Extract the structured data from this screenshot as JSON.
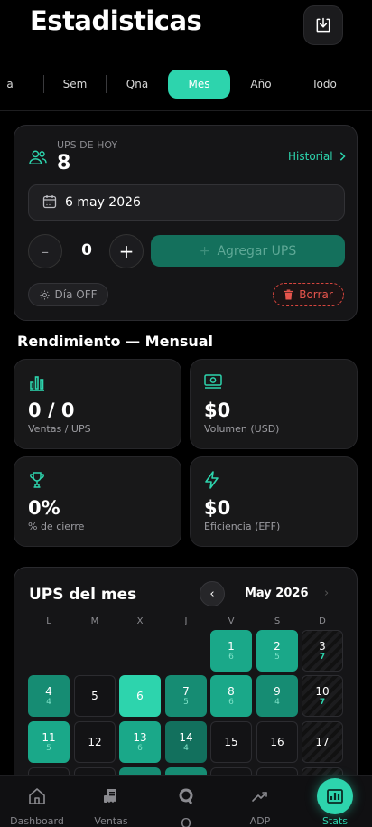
{
  "header": {
    "title": "Estadisticas"
  },
  "tabs": [
    "a",
    "Sem",
    "Qna",
    "Mes",
    "Año",
    "Todo"
  ],
  "active_tab": "Mes",
  "ups_card": {
    "label": "UPS DE HOY",
    "value": "8",
    "history_label": "Historial",
    "date": "6 may 2026",
    "quantity": "0",
    "minus": "–",
    "plus": "+",
    "add_button": "Agregar UPS",
    "add_icon": "+",
    "day_off": "Día OFF",
    "delete": "Borrar"
  },
  "performance": {
    "title": "Rendimiento — Mensual",
    "metrics": [
      {
        "icon": "bar-chart-icon",
        "value": "0 / 0",
        "label": "Ventas / UPS"
      },
      {
        "icon": "money-icon",
        "value": "$0",
        "label": "Volumen (USD)"
      },
      {
        "icon": "trophy-icon",
        "value": "0%",
        "label": "% de cierre"
      },
      {
        "icon": "lightning-icon",
        "value": "$0",
        "label": "Eficiencia (EFF)"
      }
    ]
  },
  "calendar": {
    "title": "UPS del mes",
    "month": "May 2026",
    "prev": "‹",
    "next": "›",
    "weekdays": [
      "L",
      "M",
      "X",
      "J",
      "V",
      "S",
      "D"
    ],
    "days": [
      {
        "n": "1",
        "s": "6"
      },
      {
        "n": "2",
        "s": "5"
      },
      {
        "n": "3",
        "s": "7"
      },
      {
        "n": "4",
        "s": "4"
      },
      {
        "n": "5",
        "s": ""
      },
      {
        "n": "6",
        "s": ""
      },
      {
        "n": "7",
        "s": "5"
      },
      {
        "n": "8",
        "s": "6"
      },
      {
        "n": "9",
        "s": "4"
      },
      {
        "n": "10",
        "s": "7"
      },
      {
        "n": "11",
        "s": "5"
      },
      {
        "n": "12",
        "s": ""
      },
      {
        "n": "13",
        "s": "6"
      },
      {
        "n": "14",
        "s": "4"
      },
      {
        "n": "15",
        "s": ""
      },
      {
        "n": "16",
        "s": ""
      },
      {
        "n": "17",
        "s": ""
      }
    ]
  },
  "nav": [
    "Dashboard",
    "Ventas",
    "Q",
    "ADP",
    "Stats"
  ],
  "colors": {
    "accent": "#2dd4ad",
    "danger": "#e5544c",
    "background": "#000000"
  }
}
